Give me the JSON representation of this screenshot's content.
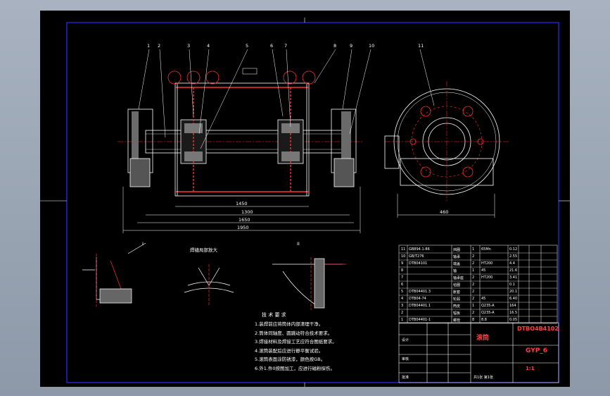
{
  "drawing": {
    "part_number": "DTBO4B4102",
    "part_name": "滚筒",
    "material": "GYP_6",
    "scale": "1:1",
    "detail_label_1": "I",
    "detail_label_2": "II",
    "detail_label_3": "焊缝局部放大"
  },
  "dimensions": {
    "d1": "1450",
    "d2": "1300",
    "d3": "1650",
    "d4": "1950",
    "d5": "460"
  },
  "callouts": [
    "1",
    "2",
    "3",
    "4",
    "5",
    "6",
    "7",
    "8",
    "9",
    "10",
    "11"
  ],
  "tech_requirements": {
    "title": "技 术 要 求",
    "items": [
      "1.装焊前应将筒体内部清理干净。",
      "2.筒体同轴度、圆跳动符合技术要求。",
      "3.焊接材料及焊接工艺应符合图纸要求。",
      "4.滚筒装配后应进行静平衡试验。",
      "5.滚筒表面涂防锈漆，颜色按GB。",
      "6.外1.件0按图加工，应进行磁粉探伤。"
    ]
  },
  "bom": {
    "rows": [
      [
        "11",
        "GB894.1-86",
        "挡圈",
        "1",
        "65Mn",
        "0.12"
      ],
      [
        "10",
        "GB/T276",
        "轴承",
        "2",
        "",
        "2.55"
      ],
      [
        "9",
        "DTB04101",
        "端盖",
        "2",
        "HT200",
        "4.4"
      ],
      [
        "8",
        "",
        "轴",
        "1",
        "45",
        "21.6"
      ],
      [
        "7",
        "",
        "轴承座",
        "2",
        "HT200",
        "3.41"
      ],
      [
        "6",
        "",
        "毡圈",
        "2",
        "",
        "0.1"
      ],
      [
        "5",
        "DTB04401.3",
        "胀套",
        "2",
        "",
        "20.1"
      ],
      [
        "4",
        "DTB04-74",
        "轮毂",
        "2",
        "45",
        "6.40"
      ],
      [
        "3",
        "DTB04401.1",
        "筒皮",
        "1",
        "Q235-A",
        "164"
      ],
      [
        "2",
        "",
        "辐板",
        "2",
        "Q235-A",
        "16.5"
      ],
      [
        "1",
        "DTB04401-1",
        "螺栓",
        "8",
        "8.8",
        "0.05"
      ]
    ]
  },
  "title_block": {
    "design": "设计",
    "check": "审核",
    "approve": "批准",
    "sheet": "共1张 第1张"
  }
}
